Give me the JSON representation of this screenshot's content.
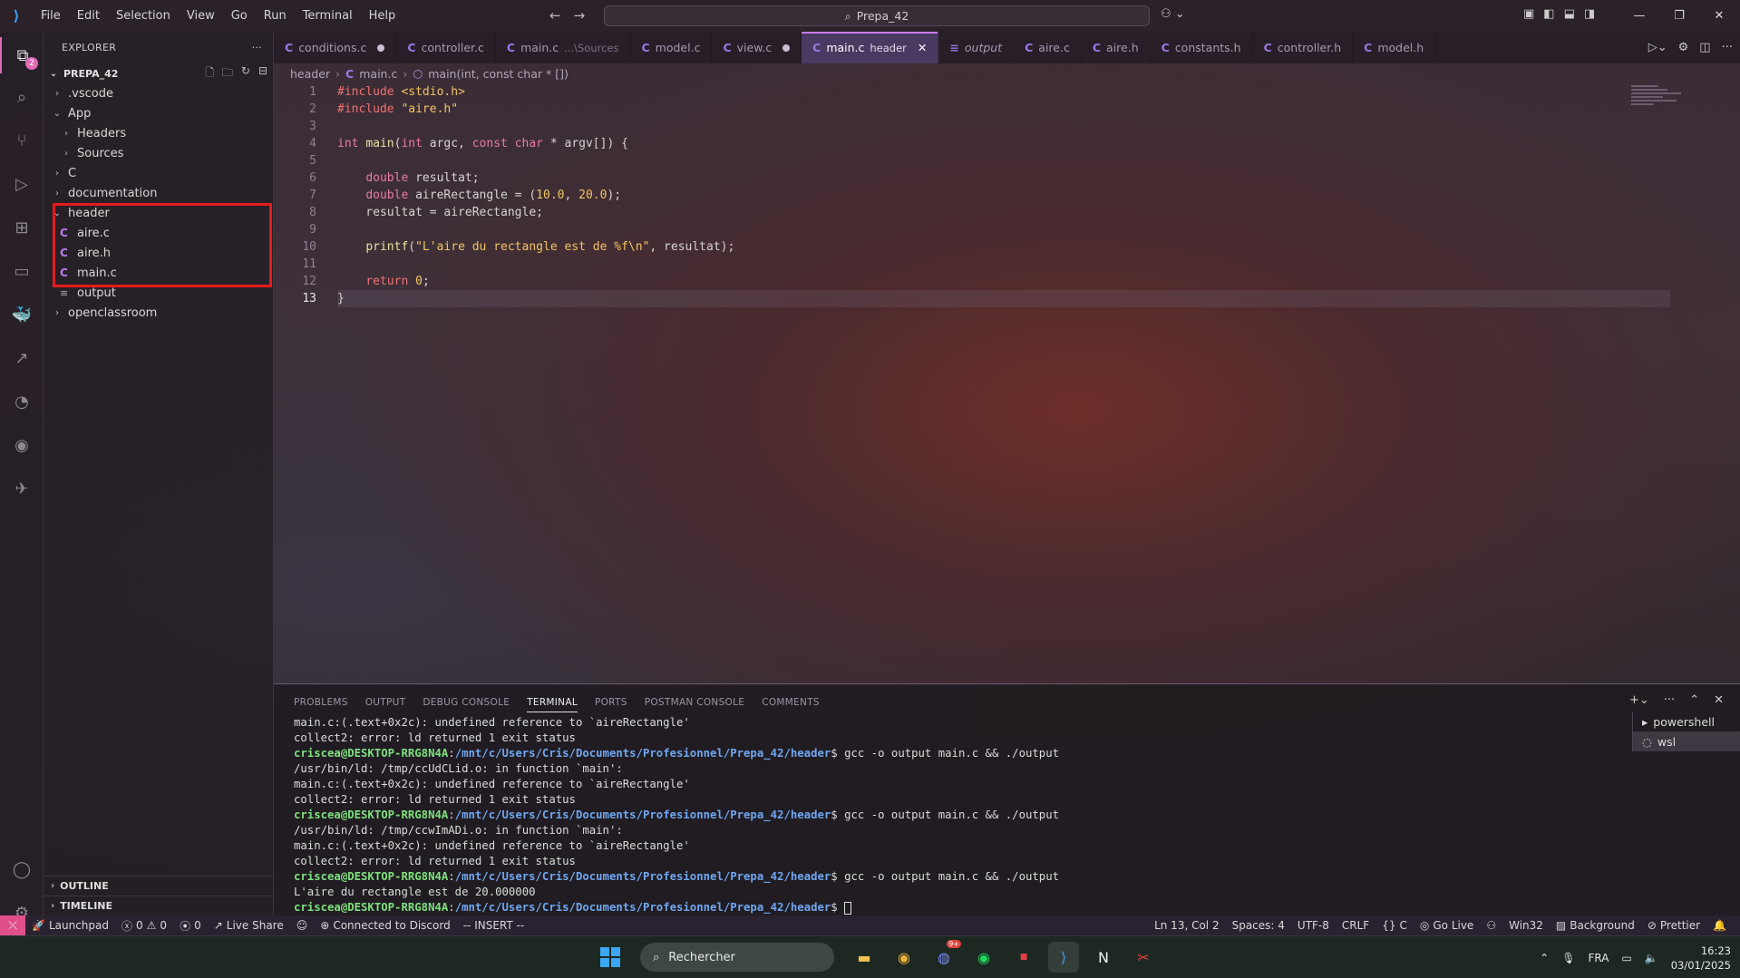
{
  "titlebar": {
    "menu": [
      "File",
      "Edit",
      "Selection",
      "View",
      "Go",
      "Run",
      "Terminal",
      "Help"
    ],
    "search_text": "Prepa_42"
  },
  "activity": {
    "explorer_badge": "2"
  },
  "sidebar": {
    "title": "EXPLORER",
    "project": "PREPA_42",
    "tree": [
      {
        "label": ".vscode",
        "kind": "folder",
        "depth": 1,
        "open": false
      },
      {
        "label": "App",
        "kind": "folder",
        "depth": 1,
        "open": true
      },
      {
        "label": "Headers",
        "kind": "folder",
        "depth": 2,
        "open": false
      },
      {
        "label": "Sources",
        "kind": "folder",
        "depth": 2,
        "open": false
      },
      {
        "label": "C",
        "kind": "folder",
        "depth": 1,
        "open": false
      },
      {
        "label": "documentation",
        "kind": "folder",
        "depth": 1,
        "open": false
      },
      {
        "label": "header",
        "kind": "folder",
        "depth": 1,
        "open": true
      },
      {
        "label": "aire.c",
        "kind": "c",
        "depth": 2
      },
      {
        "label": "aire.h",
        "kind": "c",
        "depth": 2
      },
      {
        "label": "main.c",
        "kind": "c",
        "depth": 2
      },
      {
        "label": "output",
        "kind": "file",
        "depth": 2
      },
      {
        "label": "openclassroom",
        "kind": "folder",
        "depth": 1,
        "open": false
      }
    ],
    "outline": "OUTLINE",
    "timeline": "TIMELINE"
  },
  "tabs": [
    {
      "label": "conditions.c",
      "hint": "",
      "dot": true,
      "active": false,
      "icon": "C"
    },
    {
      "label": "controller.c",
      "hint": "",
      "dot": false,
      "active": false,
      "icon": "C"
    },
    {
      "label": "main.c",
      "hint": "...\\Sources",
      "dot": false,
      "active": false,
      "icon": "C"
    },
    {
      "label": "model.c",
      "hint": "",
      "dot": false,
      "active": false,
      "icon": "C"
    },
    {
      "label": "view.c",
      "hint": "",
      "dot": true,
      "active": false,
      "icon": "C"
    },
    {
      "label": "main.c",
      "hint": "header",
      "dot": false,
      "active": true,
      "icon": "C"
    },
    {
      "label": "output",
      "hint": "",
      "dot": false,
      "active": false,
      "icon": "≡"
    },
    {
      "label": "aire.c",
      "hint": "",
      "dot": false,
      "active": false,
      "icon": "C"
    },
    {
      "label": "aire.h",
      "hint": "",
      "dot": false,
      "active": false,
      "icon": "C"
    },
    {
      "label": "constants.h",
      "hint": "",
      "dot": false,
      "active": false,
      "icon": "C"
    },
    {
      "label": "controller.h",
      "hint": "",
      "dot": false,
      "active": false,
      "icon": "C"
    },
    {
      "label": "model.h",
      "hint": "",
      "dot": false,
      "active": false,
      "icon": "C"
    }
  ],
  "breadcrumb": {
    "folder": "header",
    "file": "main.c",
    "symbol": "main(int, const char * [])"
  },
  "editor": {
    "current_line": 13,
    "lines": [
      "#include <stdio.h>",
      "#include \"aire.h\"",
      "",
      "int main(int argc, const char * argv[]) {",
      "",
      "    double resultat;",
      "    double aireRectangle = (10.0, 20.0);",
      "    resultat = aireRectangle;",
      "",
      "    printf(\"L'aire du rectangle est de %f\\n\", resultat);",
      "",
      "    return 0;",
      "}"
    ]
  },
  "panel": {
    "tabs": [
      "PROBLEMS",
      "OUTPUT",
      "DEBUG CONSOLE",
      "TERMINAL",
      "PORTS",
      "POSTMAN CONSOLE",
      "COMMENTS"
    ],
    "active_tab": "TERMINAL",
    "shells": [
      "powershell",
      "wsl"
    ],
    "terminal": [
      {
        "text": "main.c:(.text+0x2c): undefined reference to `aireRectangle'"
      },
      {
        "text": "collect2: error: ld returned 1 exit status"
      },
      {
        "user": "criscea@DESKTOP-RRG8N4A",
        "path": "/mnt/c/Users/Cris/Documents/Profesionnel/Prepa_42/header",
        "cmd": "$ gcc -o output main.c && ./output"
      },
      {
        "text": "/usr/bin/ld: /tmp/ccUdCLid.o: in function `main':"
      },
      {
        "text": "main.c:(.text+0x2c): undefined reference to `aireRectangle'"
      },
      {
        "text": "collect2: error: ld returned 1 exit status"
      },
      {
        "user": "criscea@DESKTOP-RRG8N4A",
        "path": "/mnt/c/Users/Cris/Documents/Profesionnel/Prepa_42/header",
        "cmd": "$ gcc -o output main.c && ./output"
      },
      {
        "text": "/usr/bin/ld: /tmp/ccwImADi.o: in function `main':"
      },
      {
        "text": "main.c:(.text+0x2c): undefined reference to `aireRectangle'"
      },
      {
        "text": "collect2: error: ld returned 1 exit status"
      },
      {
        "user": "criscea@DESKTOP-RRG8N4A",
        "path": "/mnt/c/Users/Cris/Documents/Profesionnel/Prepa_42/header",
        "cmd": "$ gcc -o output main.c && ./output"
      },
      {
        "text": "L'aire du rectangle est de 20.000000"
      },
      {
        "user": "criscea@DESKTOP-RRG8N4A",
        "path": "/mnt/c/Users/Cris/Documents/Profesionnel/Prepa_42/header",
        "cmd": "$ ",
        "cursor": true
      }
    ]
  },
  "status": {
    "launchpad": "Launchpad",
    "errors": "0",
    "warnings": "0",
    "ports": "0",
    "live_share": "Live Share",
    "discord": "Connected to Discord",
    "mode": "-- INSERT --",
    "position": "Ln 13, Col 2",
    "spaces": "Spaces: 4",
    "encoding": "UTF-8",
    "eol": "CRLF",
    "language": "C",
    "go_live": "Go Live",
    "platform": "Win32",
    "background": "Background",
    "prettier": "Prettier"
  },
  "taskbar": {
    "search": "Rechercher",
    "lang": "FRA",
    "time": "16:23",
    "date": "03/01/2025",
    "discord_badge": "9+"
  },
  "colors": {
    "accent": "#e06bb7",
    "active_tab": "#4a3a62",
    "highlight_box": "#e51b1b"
  }
}
